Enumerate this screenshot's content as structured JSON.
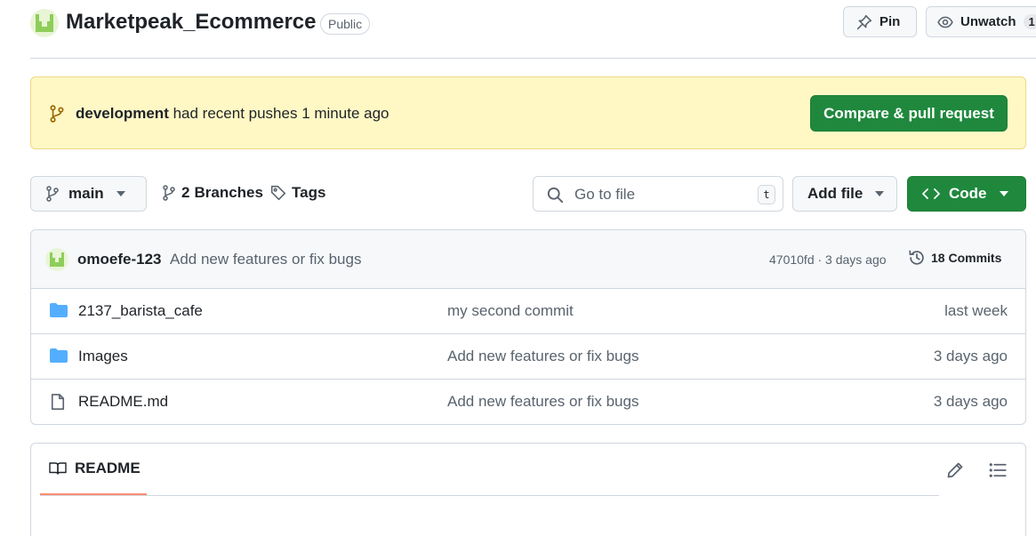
{
  "repo": {
    "name": "Marketpeak_Ecommerce",
    "visibility": "Public",
    "pin_label": "Pin",
    "watch_label": "Unwatch",
    "watch_count": "1"
  },
  "banner": {
    "branch": "development",
    "text": "had recent pushes 1 minute ago",
    "button_label": "Compare & pull request"
  },
  "toolbar": {
    "branch_name": "main",
    "branches_count": "2",
    "branches_label": "Branches",
    "tags_label": "Tags",
    "search_placeholder": "Go to file",
    "search_shortcut": "t",
    "add_file_label": "Add file",
    "code_label": "Code"
  },
  "latest_commit": {
    "author": "omoefe-123",
    "message": "Add new features or fix bugs",
    "hash_time": "47010fd · 3 days ago",
    "commits_label": "18 Commits"
  },
  "files": [
    {
      "name": "2137_barista_cafe",
      "type": "folder",
      "message": "my second commit",
      "date": "last week"
    },
    {
      "name": "Images",
      "type": "folder",
      "message": "Add new features or fix bugs",
      "date": "3 days ago"
    },
    {
      "name": "README.md",
      "type": "file",
      "message": "Add new features or fix bugs",
      "date": "3 days ago"
    }
  ],
  "readme": {
    "tab_label": "README"
  },
  "colors": {
    "primary_green": "#1f883d",
    "banner_bg": "#fff8c5",
    "folder_blue": "#54aeff",
    "tab_underline": "#fd8c73"
  }
}
